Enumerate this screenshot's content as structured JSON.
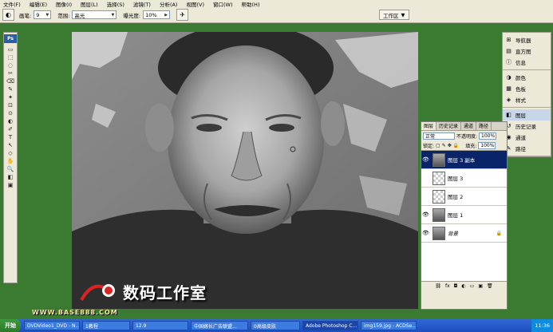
{
  "menu": [
    "文件(F)",
    "编辑(E)",
    "图像(I)",
    "图层(L)",
    "选择(S)",
    "滤镜(T)",
    "分析(A)",
    "视图(V)",
    "窗口(W)",
    "帮助(H)"
  ],
  "options": {
    "brush_label": "画笔:",
    "brush_value": "9",
    "range_label": "范围:",
    "range_value": "高光",
    "exposure_label": "曝光度:",
    "exposure_value": "10%",
    "workspace_label": "工作区"
  },
  "toolbox": {
    "logo": "Ps",
    "tools": [
      "▭",
      "⬚",
      "◌",
      "✂",
      "⌫",
      "✎",
      "✦",
      "⊡",
      "⊙",
      "◐",
      "✐",
      "T",
      "↖",
      "◇",
      "✋",
      "🔍",
      "◧",
      "▣"
    ]
  },
  "dock": {
    "group1": [
      "导航器",
      "直方图",
      "信息"
    ],
    "group2": [
      "颜色",
      "色板",
      "样式"
    ],
    "group3": [
      "图层",
      "历史记录",
      "通道",
      "路径"
    ]
  },
  "layers_panel": {
    "tabs": [
      "图层",
      "历史记录",
      "通道",
      "路径"
    ],
    "blend_mode": "正常",
    "opacity_label": "不透明度:",
    "opacity_value": "100%",
    "lock_label": "锁定:",
    "fill_label": "填充:",
    "fill_value": "100%",
    "layers": [
      {
        "name": "图层 3 副本",
        "visible": true,
        "selected": true,
        "thumb": "photo"
      },
      {
        "name": "图层 3",
        "visible": false,
        "selected": false,
        "thumb": "transparent"
      },
      {
        "name": "图层 2",
        "visible": false,
        "selected": false,
        "thumb": "transparent"
      },
      {
        "name": "图层 1",
        "visible": true,
        "selected": false,
        "thumb": "photo"
      },
      {
        "name": "背景",
        "visible": true,
        "selected": false,
        "thumb": "photo",
        "locked": true
      }
    ]
  },
  "watermark": {
    "brand": "数码工作室",
    "url": "WWW.BASE888.COM"
  },
  "taskbar": {
    "start": "开始",
    "tasks": [
      "DVDVideo1_DVD - N...",
      "1教程",
      "12.9",
      "中国嫁长广告联盟...",
      "0高级皮肤",
      "Adobe Photoshop C...",
      "img159.jpg - ACDSe..."
    ],
    "active_index": 5,
    "clock": "11:36"
  }
}
